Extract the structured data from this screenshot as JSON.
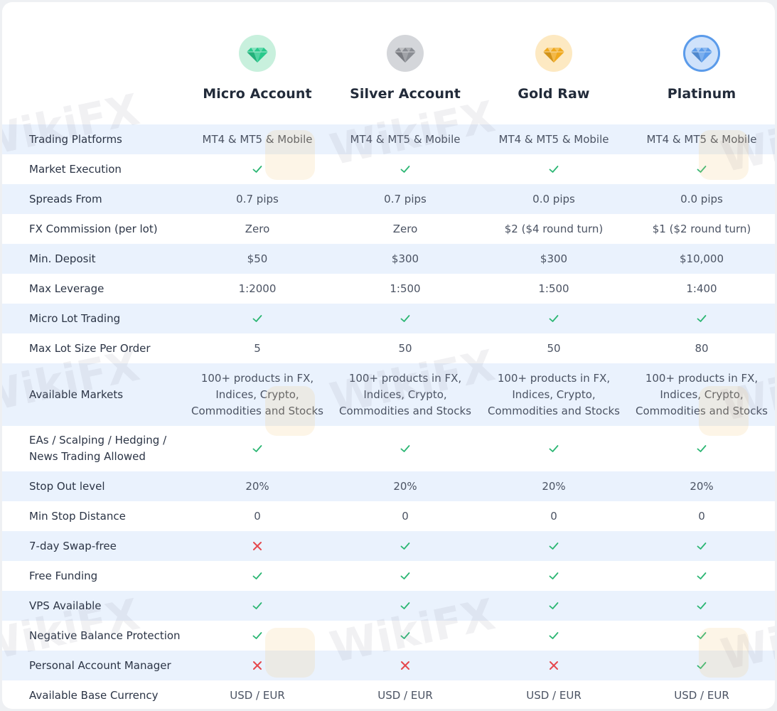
{
  "colors": {
    "row_alt_bg": "#eaf2fd",
    "check": "#2bb673",
    "cross": "#e5484d"
  },
  "plans": [
    {
      "name": "Micro Account",
      "icon": "green-diamond-icon",
      "gem_bg": "#c8f0dd",
      "gem_color": "#27c98b"
    },
    {
      "name": "Silver Account",
      "icon": "silver-diamond-icon",
      "gem_bg": "#d4d6da",
      "gem_color": "#8a8d93"
    },
    {
      "name": "Gold Raw",
      "icon": "gold-diamond-icon",
      "gem_bg": "#fde9c2",
      "gem_color": "#f0a81c"
    },
    {
      "name": "Platinum",
      "icon": "platinum-diamond-icon",
      "gem_bg": "#cfe2fb",
      "gem_color": "#5b9bea"
    }
  ],
  "rows": [
    {
      "label": "Trading Platforms",
      "values": [
        "MT4 & MT5 & Mobile",
        "MT4 & MT5 & Mobile",
        "MT4 & MT5 & Mobile",
        "MT4 & MT5 & Mobile"
      ]
    },
    {
      "label": "Market Execution",
      "values": [
        "check",
        "check",
        "check",
        "check"
      ]
    },
    {
      "label": "Spreads From",
      "values": [
        "0.7 pips",
        "0.7 pips",
        "0.0 pips",
        "0.0 pips"
      ]
    },
    {
      "label": "FX Commission (per lot)",
      "values": [
        "Zero",
        "Zero",
        "$2 ($4 round turn)",
        "$1 ($2 round turn)"
      ]
    },
    {
      "label": "Min. Deposit",
      "values": [
        "$50",
        "$300",
        "$300",
        "$10,000"
      ]
    },
    {
      "label": "Max Leverage",
      "values": [
        "1:2000",
        "1:500",
        "1:500",
        "1:400"
      ]
    },
    {
      "label": "Micro Lot Trading",
      "values": [
        "check",
        "check",
        "check",
        "check"
      ]
    },
    {
      "label": "Max Lot Size Per Order",
      "values": [
        "5",
        "50",
        "50",
        "80"
      ]
    },
    {
      "label": "Available Markets",
      "values": [
        "100+ products in FX, Indices, Crypto, Commodities and Stocks",
        "100+ products in FX, Indices, Crypto, Commodities and Stocks",
        "100+ products in FX, Indices, Crypto, Commodities and Stocks",
        "100+ products in FX, Indices, Crypto, Commodities and Stocks"
      ]
    },
    {
      "label": "EAs / Scalping / Hedging / News Trading Allowed",
      "values": [
        "check",
        "check",
        "check",
        "check"
      ]
    },
    {
      "label": "Stop Out level",
      "values": [
        "20%",
        "20%",
        "20%",
        "20%"
      ]
    },
    {
      "label": "Min Stop Distance",
      "values": [
        "0",
        "0",
        "0",
        "0"
      ]
    },
    {
      "label": "7-day Swap-free",
      "values": [
        "cross",
        "check",
        "check",
        "check"
      ]
    },
    {
      "label": "Free Funding",
      "values": [
        "check",
        "check",
        "check",
        "check"
      ]
    },
    {
      "label": "VPS Available",
      "values": [
        "check",
        "check",
        "check",
        "check"
      ]
    },
    {
      "label": "Negative Balance Protection",
      "values": [
        "check",
        "check",
        "check",
        "check"
      ]
    },
    {
      "label": "Personal Account Manager",
      "values": [
        "cross",
        "cross",
        "cross",
        "check"
      ]
    },
    {
      "label": "Available Base Currency",
      "values": [
        "USD / EUR",
        "USD / EUR",
        "USD / EUR",
        "USD / EUR"
      ]
    }
  ],
  "watermark": "WikiFX"
}
